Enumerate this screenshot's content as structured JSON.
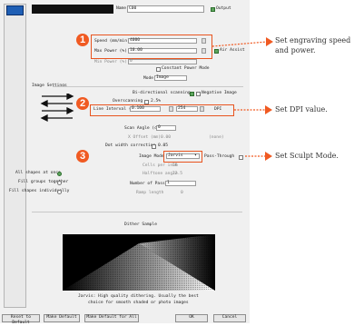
{
  "top": {
    "name_label": "Name",
    "name_value": "C00",
    "output_label": "Output"
  },
  "laser": {
    "speed_label": "Speed (mm/min)",
    "speed_value": "4000",
    "max_power_label": "Max Power (%)",
    "max_power_value": "10.00",
    "min_power_label": "Min Power (%)",
    "min_power_value": "0",
    "air_assist_label": "Air Assist",
    "constant_power_label": "Constant Power Mode",
    "mode_label": "Mode",
    "mode_value": "Image"
  },
  "image_settings": {
    "section_title": "Image Settings",
    "bidirectional_label": "Bi-directional scanning",
    "negative_label": "Negative Image",
    "overscanning_label": "Overscanning",
    "overscanning_value": "2.5%",
    "line_interval_label": "Line Interval (mm)",
    "line_interval_value": "0.100",
    "dpi_value": "254",
    "dpi_unit": "DPI",
    "scan_angle_label": "Scan Angle (deg)",
    "scan_angle_value": "0",
    "x_offset_label": "X Offset (mm)",
    "x_offset_value": "0.00",
    "x_offset_note": "(none)",
    "dot_width_label": "Dot width correction",
    "dot_width_value": "0.05",
    "image_mode_label": "Image Mode",
    "image_mode_value": "Jarvis",
    "passthrough_label": "Pass-Through",
    "cells_label": "Cells per inch",
    "cells_value": "50",
    "halftone_label": "Halftone angle",
    "halftone_value": "22.5",
    "passes_label": "Number of Passes",
    "passes_value": "1",
    "ramp_label": "Ramp length",
    "ramp_value": "0",
    "all_shapes_label": "All shapes at once",
    "fill_groups_label": "Fill groups together",
    "fill_individually_label": "Fill shapes individually"
  },
  "dither": {
    "title": "Dither Sample",
    "caption_line1": "Jarvis: High quality dithering. Usually the best",
    "caption_line2": "choice for smooth shaded or photo images"
  },
  "buttons": {
    "reset": "Reset to Default",
    "make_default": "Make Default",
    "make_default_all": "Make Default for All",
    "ok": "OK",
    "cancel": "Cancel"
  },
  "annotations": {
    "badge1": "1",
    "badge2": "2",
    "badge3": "3",
    "callout1_line1": "Set engraving speed",
    "callout1_line2": "and power.",
    "callout2": "Set DPI value.",
    "callout3": "Set Sculpt Mode."
  },
  "colors": {
    "accent": "#f05a22",
    "checked": "#5ea55e",
    "layer_swatch": "#1f5fb5"
  }
}
